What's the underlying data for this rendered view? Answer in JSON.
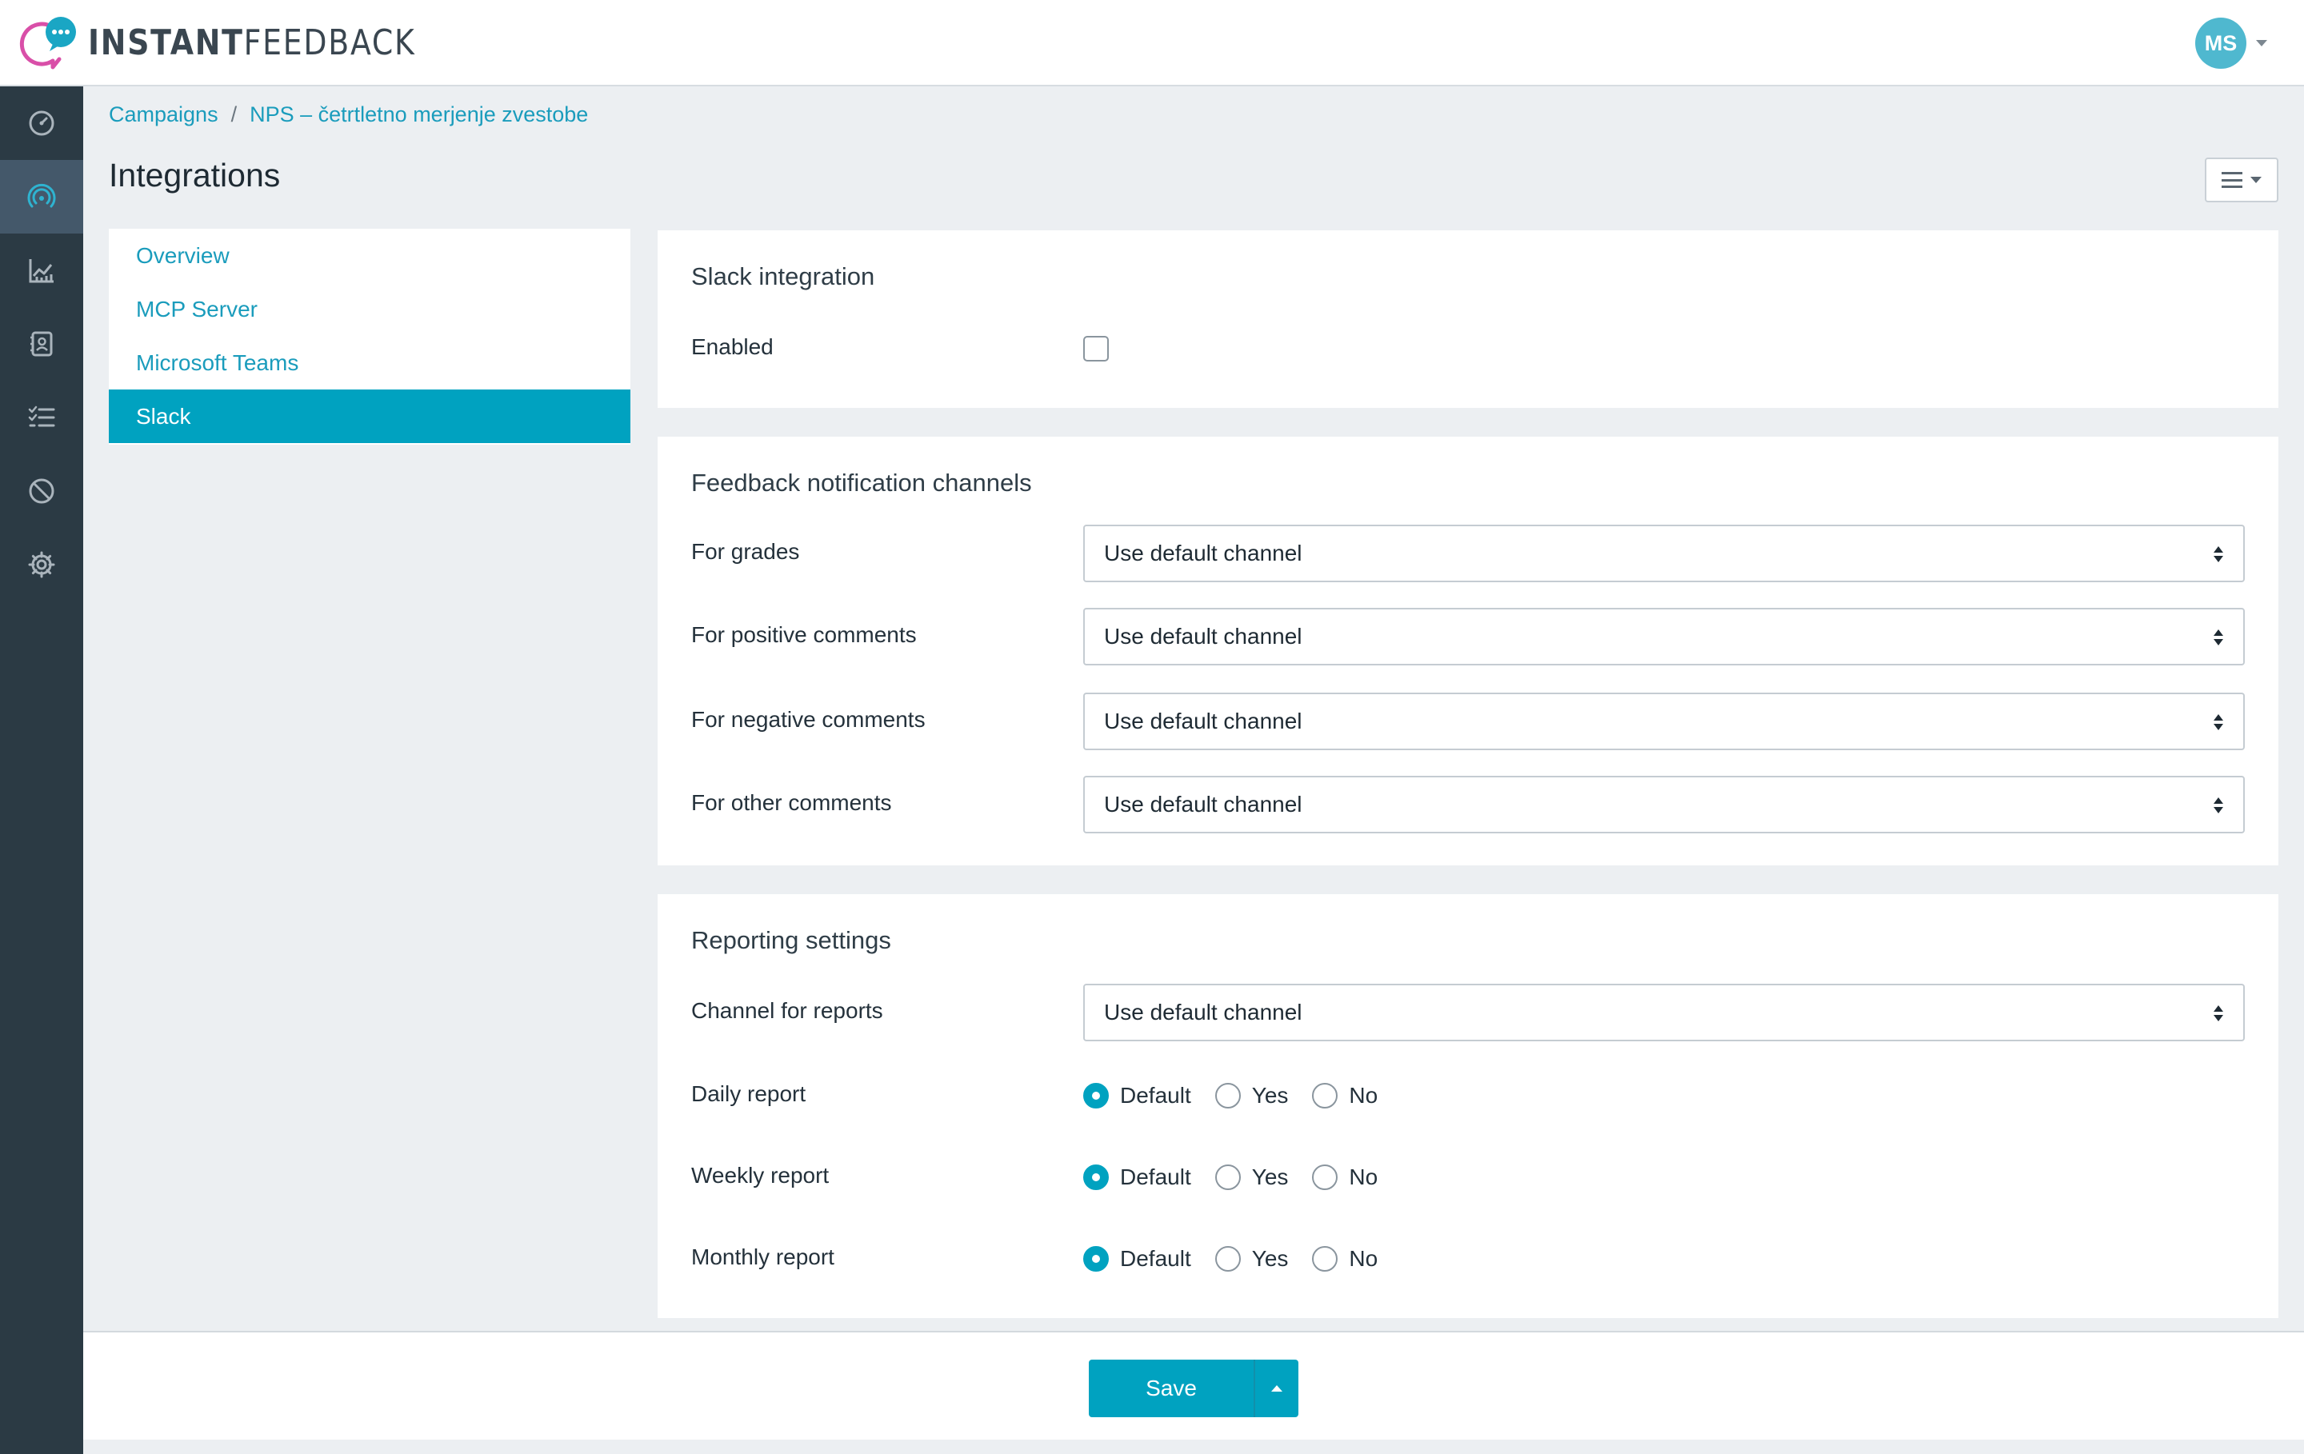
{
  "app": {
    "logo_bold": "INSTANT",
    "logo_light": "FEEDBACK",
    "brand_accent": "#00a2c0",
    "logo_pink": "#d94fa8"
  },
  "user": {
    "initials": "MS"
  },
  "sidebar": {
    "items": [
      {
        "icon": "dashboard-gauge-icon",
        "active": false
      },
      {
        "icon": "campaigns-broadcast-icon",
        "active": true
      },
      {
        "icon": "analytics-chart-icon",
        "active": false
      },
      {
        "icon": "contacts-book-icon",
        "active": false
      },
      {
        "icon": "checklist-icon",
        "active": false
      },
      {
        "icon": "blocked-icon",
        "active": false
      },
      {
        "icon": "settings-gear-icon",
        "active": false
      }
    ]
  },
  "breadcrumb": {
    "items": [
      "Campaigns",
      "NPS – četrtletno merjenje zvestobe"
    ],
    "separator": "/"
  },
  "page": {
    "title": "Integrations"
  },
  "subnav": {
    "items": [
      {
        "label": "Overview",
        "active": false
      },
      {
        "label": "MCP Server",
        "active": false
      },
      {
        "label": "Microsoft Teams",
        "active": false
      },
      {
        "label": "Slack",
        "active": true
      }
    ]
  },
  "slack_panel": {
    "title": "Slack integration",
    "enabled_label": "Enabled",
    "enabled": false
  },
  "channels_panel": {
    "title": "Feedback notification channels",
    "rows": [
      {
        "label": "For grades",
        "value": "Use default channel"
      },
      {
        "label": "For positive comments",
        "value": "Use default channel"
      },
      {
        "label": "For negative comments",
        "value": "Use default channel"
      },
      {
        "label": "For other comments",
        "value": "Use default channel"
      }
    ]
  },
  "reporting_panel": {
    "title": "Reporting settings",
    "channel_label": "Channel for reports",
    "channel_value": "Use default channel",
    "options": [
      "Default",
      "Yes",
      "No"
    ],
    "reports": [
      {
        "label": "Daily report",
        "selected": "Default"
      },
      {
        "label": "Weekly report",
        "selected": "Default"
      },
      {
        "label": "Monthly report",
        "selected": "Default"
      }
    ]
  },
  "footer": {
    "save_label": "Save"
  }
}
